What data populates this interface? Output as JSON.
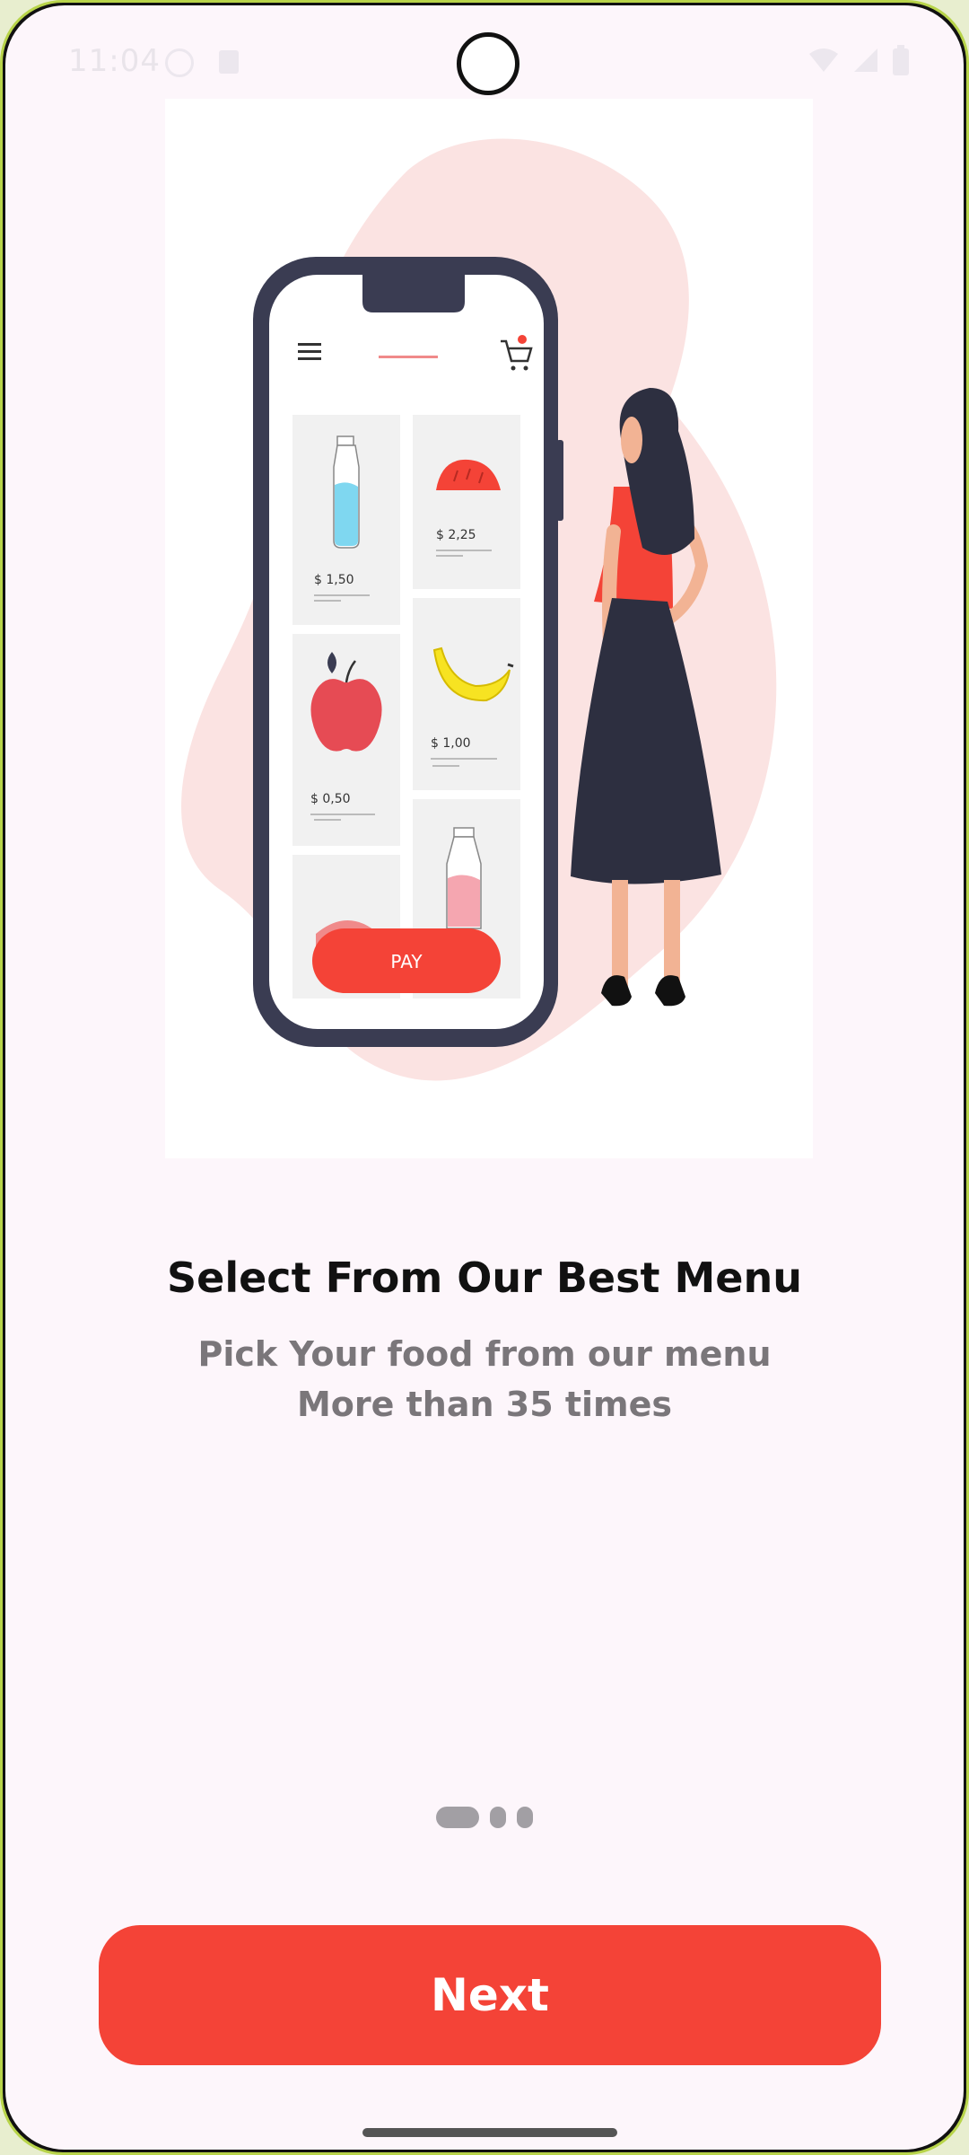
{
  "status_bar": {
    "time": "11:04"
  },
  "illustration": {
    "description": "onboarding-illustration",
    "phone_items": [
      {
        "price": "$ 1,50"
      },
      {
        "price": "$ 2,25"
      },
      {
        "price": "$ 0,50"
      },
      {
        "price": "$ 1,00"
      }
    ],
    "pay_label": "PAY"
  },
  "onboarding": {
    "title": "Select From Our Best Menu",
    "subtitle_line1": "Pick Your food from our menu",
    "subtitle_line2": "More than 35 times"
  },
  "pager": {
    "page_count": 3,
    "current_page": 1
  },
  "actions": {
    "next_label": "Next"
  },
  "colors": {
    "accent": "#f44337",
    "background": "#fdf6fb",
    "title": "#111111",
    "subtitle": "#7a767a"
  }
}
